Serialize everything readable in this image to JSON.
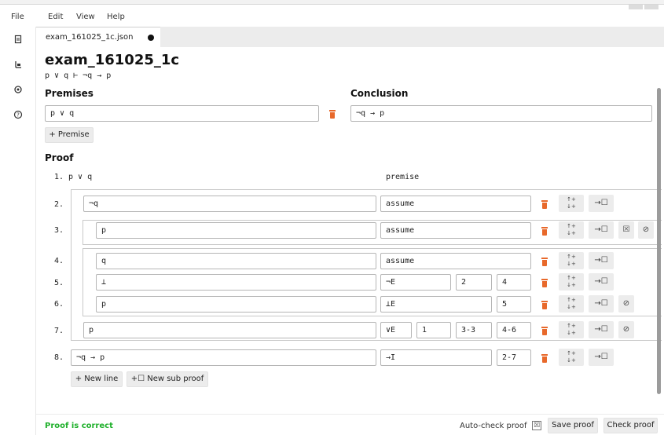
{
  "menu": {
    "file": "File",
    "edit": "Edit",
    "view": "View",
    "help": "Help"
  },
  "rail_icons": [
    "document-icon",
    "tree-icon",
    "settings-icon",
    "help-icon"
  ],
  "tab": {
    "filename": "exam_161025_1c.json"
  },
  "proof": {
    "title": "exam_161025_1c",
    "sequent": "p ∨ q ⊢ ¬q → p"
  },
  "premises_section": {
    "label": "Premises",
    "premise_value": "p ∨ q",
    "add_label": "+ Premise"
  },
  "conclusion_section": {
    "label": "Conclusion",
    "value": "¬q → p"
  },
  "proof_section": {
    "label": "Proof",
    "premise_line": {
      "number": "1.",
      "formula": "p ∨ q",
      "rule": "premise"
    },
    "lines": [
      {
        "number": "2.",
        "formula": "¬q",
        "rule": "assume",
        "refs": []
      },
      {
        "number": "3.",
        "formula": "p",
        "rule": "assume",
        "refs": []
      },
      {
        "number": "4.",
        "formula": "q",
        "rule": "assume",
        "refs": []
      },
      {
        "number": "5.",
        "formula": "⊥",
        "rule": "¬E",
        "refs": [
          "2",
          "4"
        ]
      },
      {
        "number": "6.",
        "formula": "p",
        "rule": "⊥E",
        "refs": [
          "5"
        ]
      },
      {
        "number": "7.",
        "formula": "p",
        "rule": "∨E",
        "refs": [
          "1",
          "3-3",
          "4-6"
        ]
      },
      {
        "number": "8.",
        "formula": "¬q → p",
        "rule": "→I",
        "refs": [
          "2-7"
        ]
      }
    ],
    "move_label_top": "↑+",
    "move_label_bottom": "↓+",
    "to_subproof_label": "→☐",
    "new_line_label": "+ New line",
    "new_subproof_label": "+☐ New sub proof"
  },
  "footer": {
    "status": "Proof is correct",
    "status_color": "#1fb02b",
    "autocheck_label": "Auto-check proof",
    "autocheck_mark": "☒",
    "save_label": "Save proof",
    "check_label": "Check proof"
  },
  "colors": {
    "accent_trash": "#e8692b",
    "button_bg": "#ececec"
  }
}
